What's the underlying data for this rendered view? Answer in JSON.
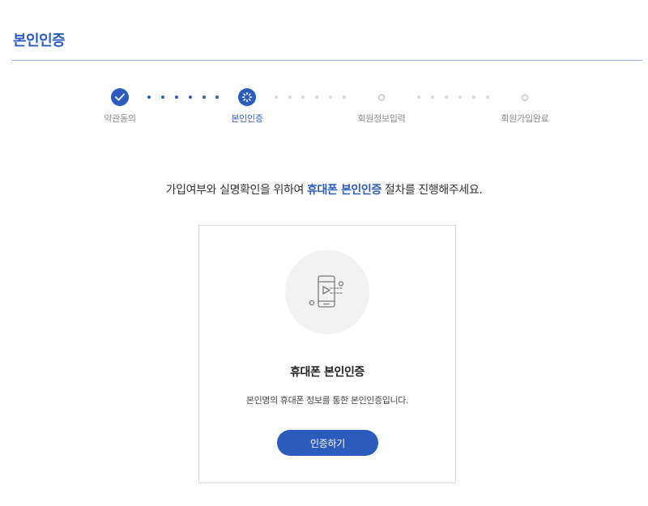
{
  "page": {
    "title": "본인인증"
  },
  "stepper": {
    "steps": [
      {
        "label": "약관동의",
        "state": "done"
      },
      {
        "label": "본인인증",
        "state": "active"
      },
      {
        "label": "회원정보입력",
        "state": "pending"
      },
      {
        "label": "회원가입완료",
        "state": "pending"
      }
    ]
  },
  "intro": {
    "before": "가입여부와 실명확인을 위하여 ",
    "highlight": "휴대폰 본인인증",
    "after": " 절차를 진행해주세요."
  },
  "card": {
    "icon": "mobile-phone-icon",
    "title": "휴대폰 본인인증",
    "description": "본인명의 휴대폰 정보를 통한 본인인증입니다.",
    "button_label": "인증하기"
  },
  "colors": {
    "accent": "#2b5bbd",
    "rule": "#9bb0cf",
    "inactive": "#cfcfcf",
    "icon_bg": "#f2f2f2"
  }
}
